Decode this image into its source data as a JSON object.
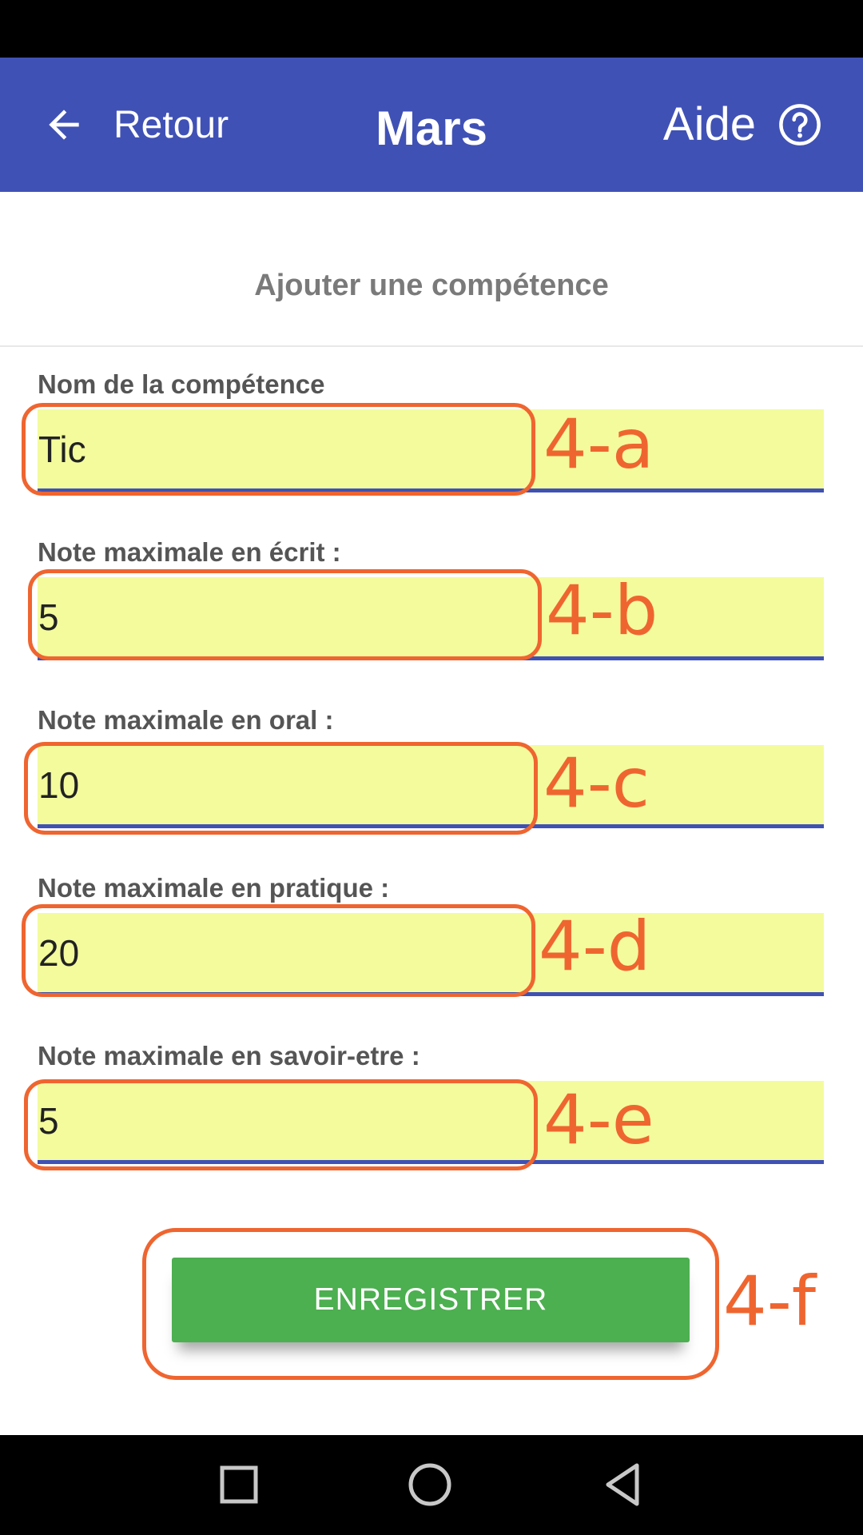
{
  "app_bar": {
    "back_label": "Retour",
    "title": "Mars",
    "help_label": "Aide",
    "color": "#4051b5"
  },
  "form": {
    "title": "Ajouter une compétence",
    "fields": [
      {
        "label": "Nom de la compétence",
        "value": "Tic",
        "annotation": "4-a"
      },
      {
        "label": "Note maximale en écrit :",
        "value": "5",
        "annotation": "4-b"
      },
      {
        "label": "Note maximale en oral :",
        "value": "10",
        "annotation": "4-c"
      },
      {
        "label": "Note maximale en pratique :",
        "value": "20",
        "annotation": "4-d"
      },
      {
        "label": "Note maximale en savoir-etre :",
        "value": "5",
        "annotation": "4-e"
      }
    ],
    "input_background": "#f3fb9d",
    "input_underline": "#3f51b5"
  },
  "save_button": {
    "label": "ENREGISTRER",
    "annotation": "4-f",
    "color": "#4caf50"
  },
  "annotation_color": "#ef6530",
  "nav_bar": {
    "icons": [
      "recent-apps-icon",
      "home-icon",
      "back-icon"
    ]
  }
}
